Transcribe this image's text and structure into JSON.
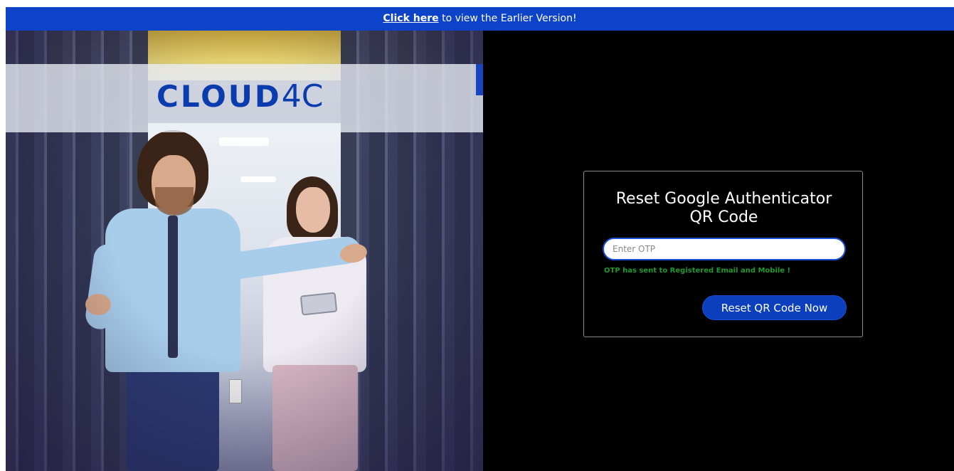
{
  "banner": {
    "link_text": "Click here",
    "rest_text": " to view the Earlier Version!"
  },
  "logo": {
    "main": "CLOUD",
    "version": "4C"
  },
  "card": {
    "title_line1": "Reset Google Authenticator",
    "title_line2": "QR Code",
    "otp_placeholder": "Enter OTP",
    "otp_value": "",
    "status_message": "OTP has sent to Registered Email and Mobile !",
    "button_label": "Reset QR Code Now"
  },
  "colors": {
    "banner_bg": "#0d43c9",
    "button_bg": "#0b3fbe",
    "status_text": "#1f9a2e",
    "logo": "#0b3cae"
  }
}
